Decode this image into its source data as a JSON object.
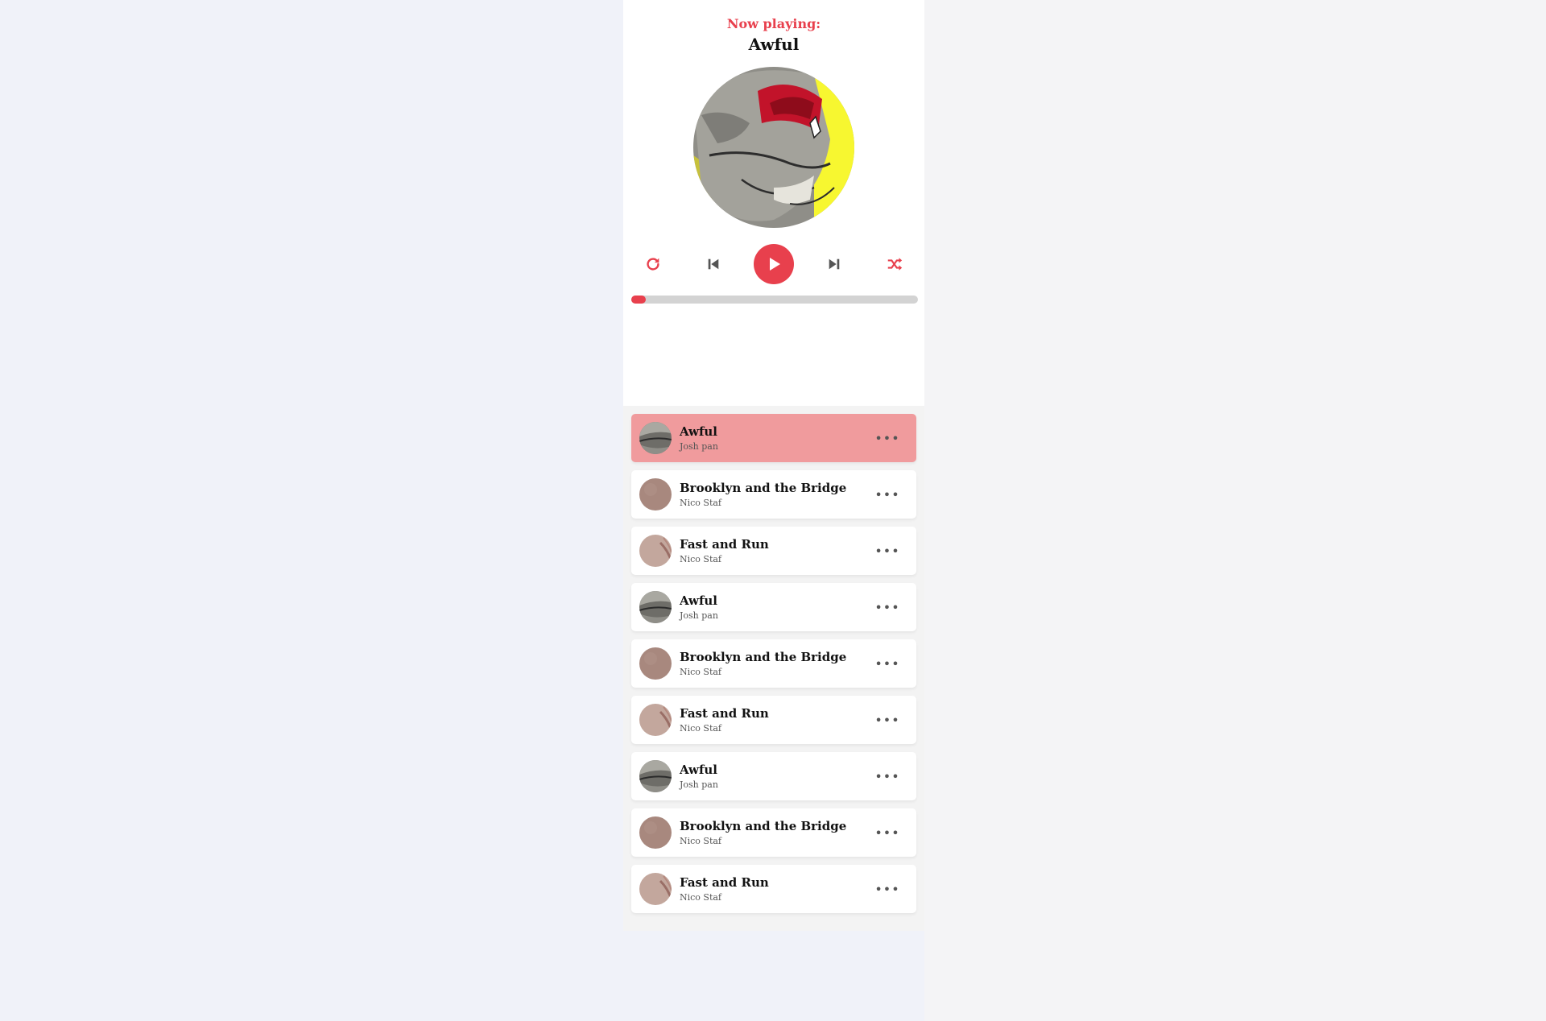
{
  "header": {
    "now_playing_label": "Now playing:",
    "current_song": "Awful"
  },
  "controls": {
    "repeat_icon": "repeat-icon",
    "prev_icon": "skip-previous-icon",
    "play_icon": "play-icon",
    "next_icon": "skip-next-icon",
    "shuffle_icon": "shuffle-icon"
  },
  "progress": {
    "value_percent": 5
  },
  "colors": {
    "accent": "#e8404d",
    "active_row": "#f09b9d",
    "background": "#f0f2f9"
  },
  "playlist": [
    {
      "title": "Awful",
      "author": "Josh pan",
      "thumb": "gray",
      "active": true
    },
    {
      "title": "Brooklyn and the Bridge",
      "author": "Nico Staf",
      "thumb": "brown",
      "active": false
    },
    {
      "title": "Fast and Run",
      "author": "Nico Staf",
      "thumb": "tan",
      "active": false
    },
    {
      "title": "Awful",
      "author": "Josh pan",
      "thumb": "gray",
      "active": false
    },
    {
      "title": "Brooklyn and the Bridge",
      "author": "Nico Staf",
      "thumb": "brown",
      "active": false
    },
    {
      "title": "Fast and Run",
      "author": "Nico Staf",
      "thumb": "tan",
      "active": false
    },
    {
      "title": "Awful",
      "author": "Josh pan",
      "thumb": "gray",
      "active": false
    },
    {
      "title": "Brooklyn and the Bridge",
      "author": "Nico Staf",
      "thumb": "brown",
      "active": false
    },
    {
      "title": "Fast and Run",
      "author": "Nico Staf",
      "thumb": "tan",
      "active": false
    }
  ],
  "more_icon": "more-options-icon",
  "more_glyph": "•••"
}
